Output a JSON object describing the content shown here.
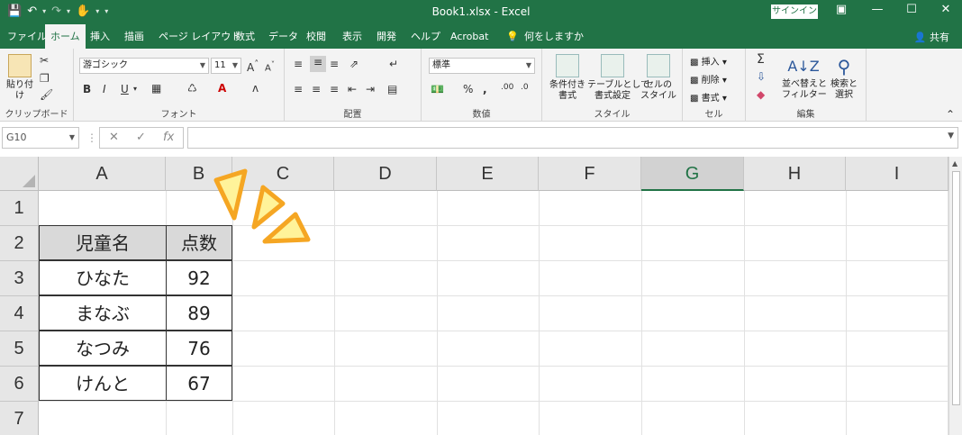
{
  "window": {
    "title": "Book1.xlsx  -  Excel",
    "signin": "サインイン"
  },
  "tabs": [
    {
      "label": "ファイル"
    },
    {
      "label": "ホーム"
    },
    {
      "label": "挿入"
    },
    {
      "label": "描画"
    },
    {
      "label": "ページ レイアウト"
    },
    {
      "label": "数式"
    },
    {
      "label": "データ"
    },
    {
      "label": "校閲"
    },
    {
      "label": "表示"
    },
    {
      "label": "開発"
    },
    {
      "label": "ヘルプ"
    },
    {
      "label": "Acrobat"
    },
    {
      "label": "何をしますか"
    }
  ],
  "share": "共有",
  "ribbon": {
    "clipboard": {
      "paste": "貼り付け",
      "label": "クリップボード"
    },
    "font": {
      "name": "游ゴシック",
      "size": "11",
      "label": "フォント"
    },
    "alignment": {
      "label": "配置"
    },
    "number": {
      "format": "標準",
      "label": "数値"
    },
    "styles": {
      "conditional": "条件付き\n書式",
      "table": "テーブルとして\n書式設定",
      "cell": "セルの\nスタイル",
      "label": "スタイル"
    },
    "cells": {
      "insert": "挿入",
      "delete": "削除",
      "format": "書式",
      "label": "セル"
    },
    "editing": {
      "sort": "並べ替えと\nフィルター",
      "find": "検索と\n選択",
      "label": "編集"
    }
  },
  "formula_bar": {
    "name_box": "G10",
    "content": ""
  },
  "sheet": {
    "columns": [
      "A",
      "B",
      "C",
      "D",
      "E",
      "F",
      "G",
      "H",
      "I"
    ],
    "selected_column": "G",
    "rows": [
      "1",
      "2",
      "3",
      "4",
      "5",
      "6",
      "7"
    ],
    "table_header": [
      "児童名",
      "点数"
    ],
    "table_rows": [
      [
        "ひなた",
        "92"
      ],
      [
        "まなぶ",
        "89"
      ],
      [
        "なつみ",
        "76"
      ],
      [
        "けんと",
        "67"
      ]
    ]
  },
  "colors": {
    "accent": "#217346",
    "header_fill": "#d9d9d9",
    "spark_fill": "#fff39a",
    "spark_stroke": "#f5a623"
  }
}
